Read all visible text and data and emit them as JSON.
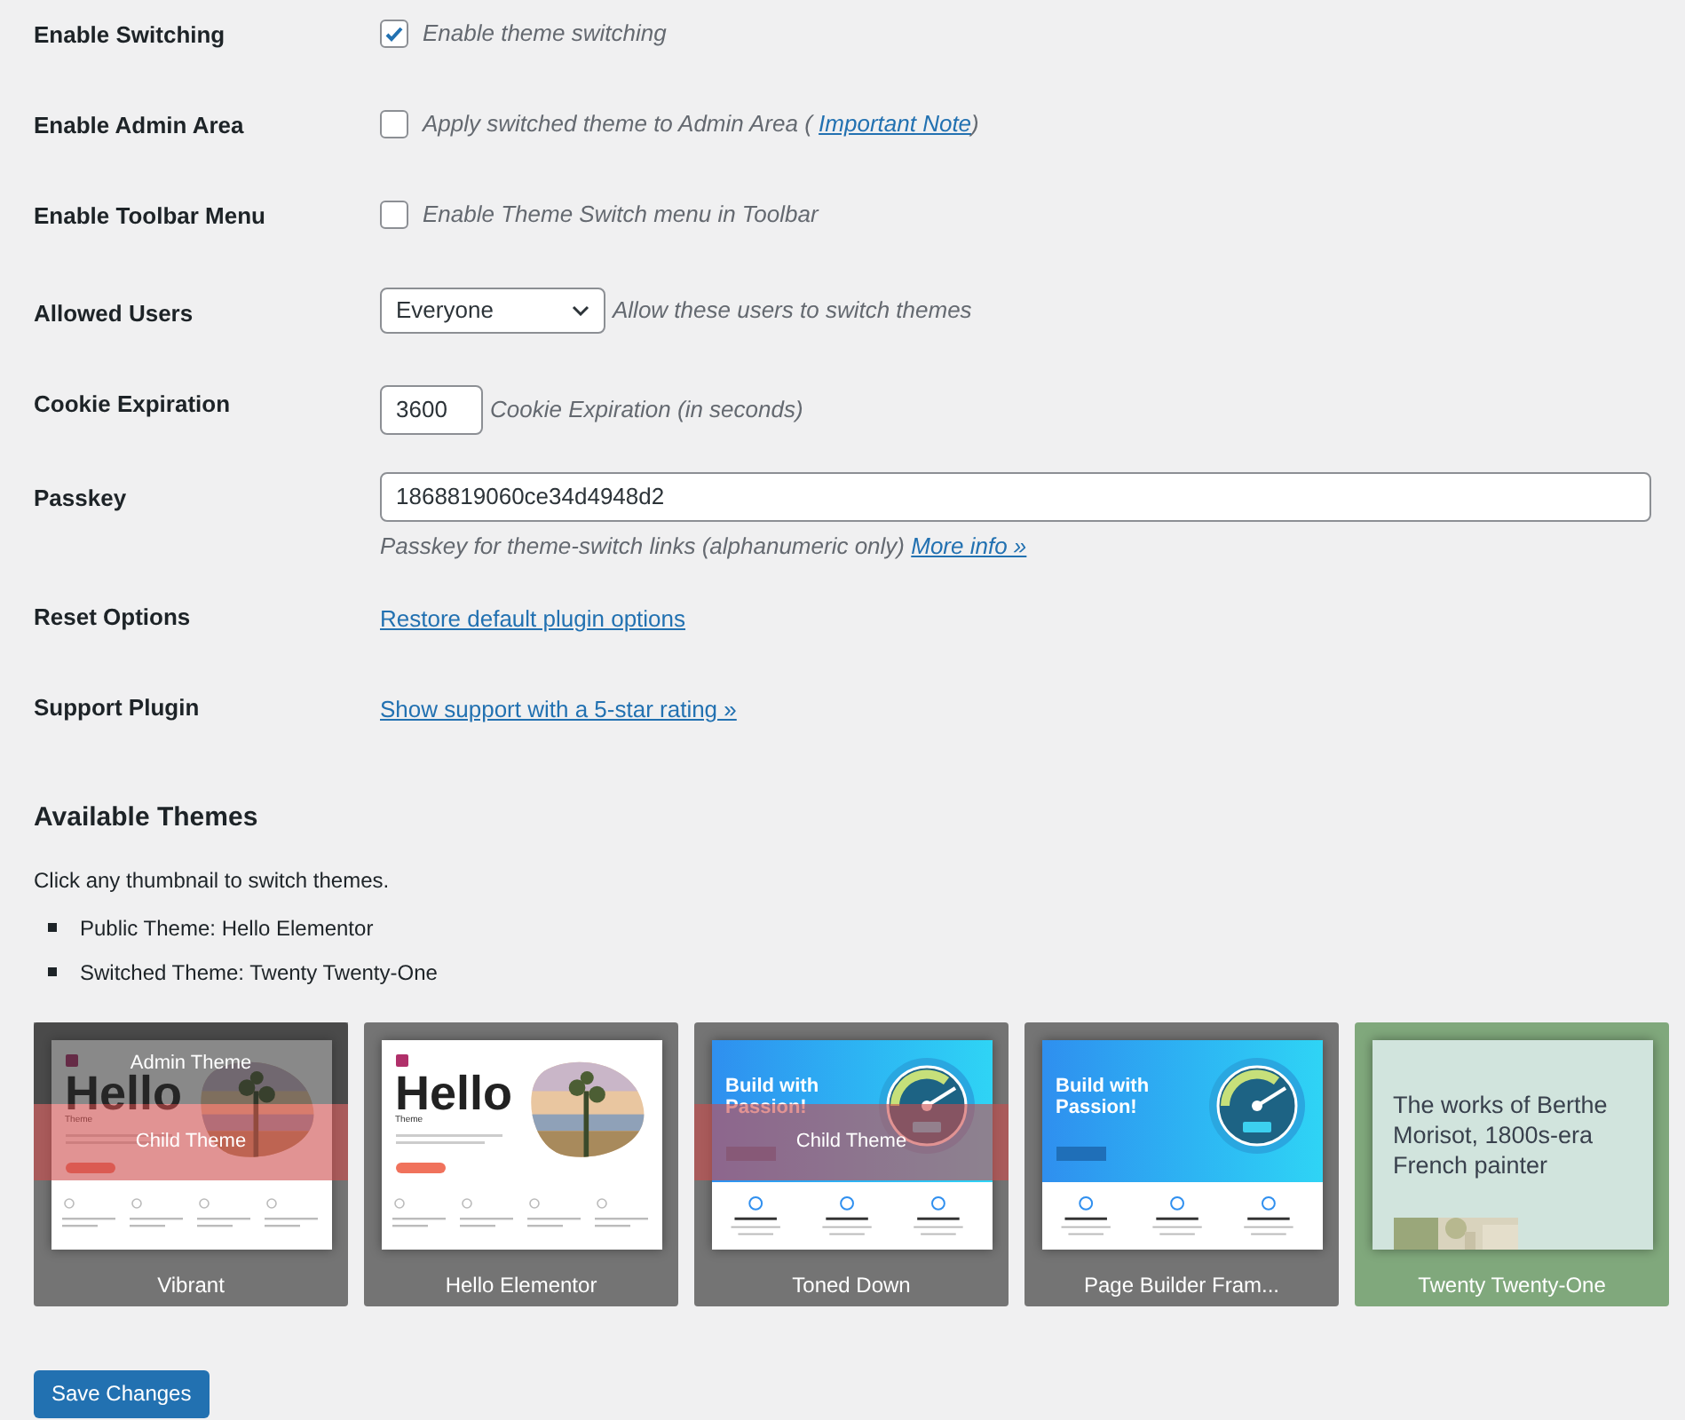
{
  "settings": [
    {
      "label": "Enable Switching",
      "kind": "checkbox",
      "checked": true,
      "description": "Enable theme switching"
    },
    {
      "label": "Enable Admin Area",
      "kind": "checkbox",
      "checked": false,
      "description": "Apply switched theme to Admin Area (",
      "link": "Important Note",
      "after": ")"
    },
    {
      "label": "Enable Toolbar Menu",
      "kind": "checkbox",
      "checked": false,
      "description": "Enable Theme Switch menu in Toolbar"
    },
    {
      "label": "Allowed Users",
      "kind": "select",
      "value": "Everyone",
      "description": "Allow these users to switch themes"
    },
    {
      "label": "Cookie Expiration",
      "kind": "number",
      "value": "3600",
      "description": "Cookie Expiration (in seconds)"
    },
    {
      "label": "Passkey",
      "kind": "text",
      "value": "1868819060ce34d4948d2",
      "description": "Passkey for theme-switch links (alphanumeric only)",
      "link": "More info »"
    },
    {
      "label": "Reset Options",
      "kind": "link",
      "link": "Restore default plugin options"
    },
    {
      "label": "Support Plugin",
      "kind": "link",
      "link": "Show support with a 5-star rating »"
    }
  ],
  "themes_section": {
    "title": "Available Themes",
    "intro": "Click any thumbnail to switch themes.",
    "notes": [
      "Public Theme: Hello Elementor",
      "Switched Theme: Twenty Twenty-One"
    ]
  },
  "themes": [
    {
      "name": "Vibrant",
      "selected": false,
      "admin_label": "Admin Theme",
      "child_label": "Child Theme",
      "preview": {
        "kind": "hello",
        "headline": "Hello",
        "subtitle": "Theme"
      }
    },
    {
      "name": "Hello Elementor",
      "selected": false,
      "preview": {
        "kind": "hello",
        "headline": "Hello",
        "subtitle": "Theme"
      }
    },
    {
      "name": "Toned Down",
      "selected": false,
      "child_label": "Child Theme",
      "preview": {
        "kind": "builder",
        "headline": "Build with Passion!"
      }
    },
    {
      "name": "Page Builder Fram...",
      "selected": false,
      "preview": {
        "kind": "builder",
        "headline": "Build with Passion!"
      }
    },
    {
      "name": "Twenty Twenty-One",
      "selected": true,
      "preview": {
        "kind": "tt1",
        "headline": "The works of Berthe Morisot, 1800s-era French painter"
      }
    }
  ],
  "save_button": "Save Changes"
}
